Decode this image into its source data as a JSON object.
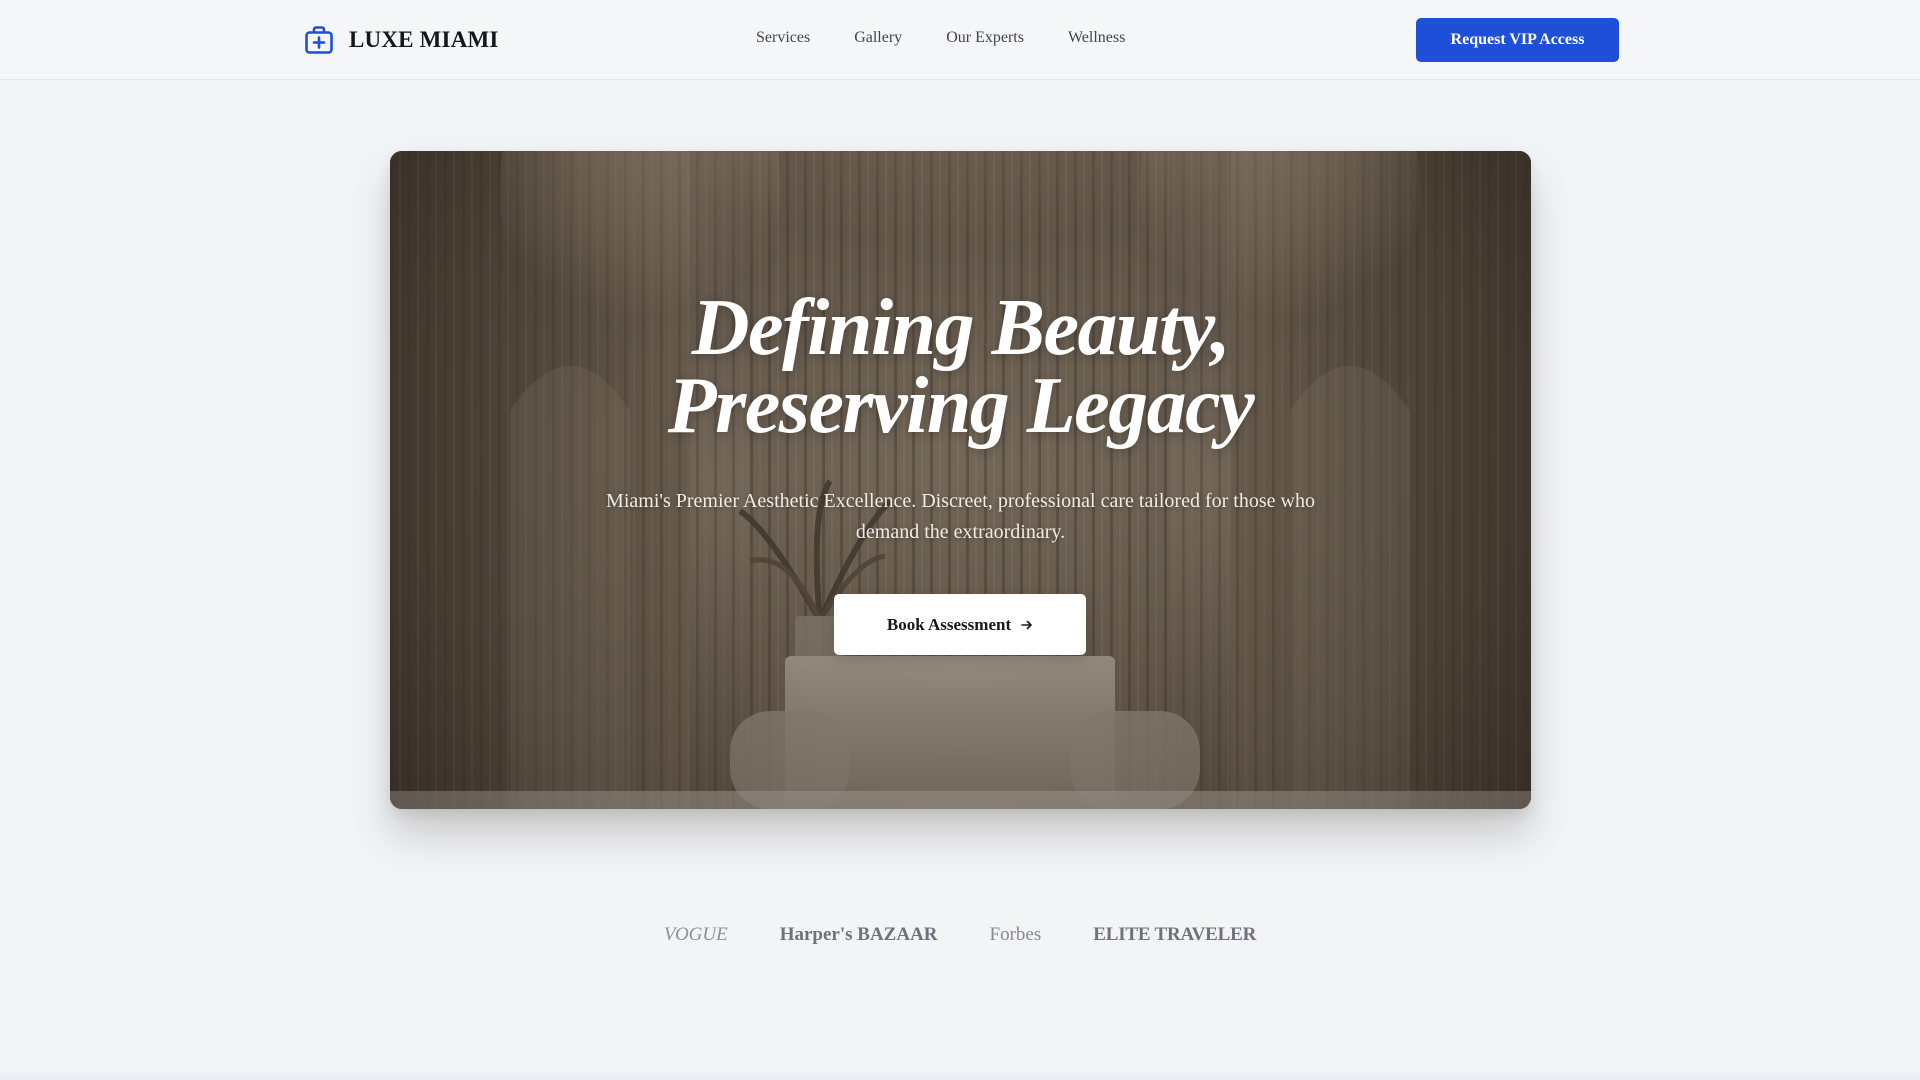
{
  "brand": {
    "name": "LUXE MIAMI",
    "icon": "medical-bag-icon",
    "accent_color": "#1d4fd8"
  },
  "nav": {
    "items": [
      {
        "label": "Services"
      },
      {
        "label": "Gallery"
      },
      {
        "label": "Our Experts"
      },
      {
        "label": "Wellness"
      }
    ]
  },
  "header": {
    "cta_label": "Request VIP Access"
  },
  "hero": {
    "title_line1": "Defining Beauty,",
    "title_line2": "Preserving Legacy",
    "subtitle": "Miami's Premier Aesthetic Excellence. Discreet, professional care tailored for those who demand the extraordinary.",
    "cta_label": "Book Assessment",
    "cta_icon": "arrow-right-icon"
  },
  "press": {
    "logos": [
      "VOGUE",
      "Harper's BAZAAR",
      "Forbes",
      "ELITE TRAVELER"
    ]
  }
}
